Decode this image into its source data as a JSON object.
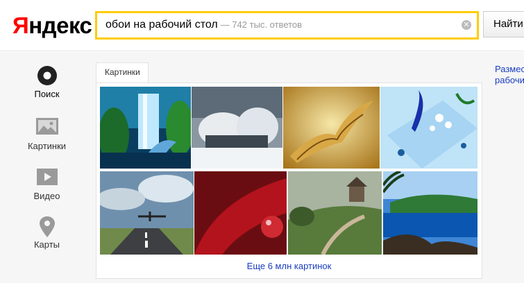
{
  "header": {
    "logo_first": "Я",
    "logo_rest": "ндекс",
    "search": {
      "query": "обои на рабочий стол",
      "hint": "— 742 тыс. ответов"
    },
    "search_button": "Найти"
  },
  "sidebar": {
    "items": [
      {
        "label": "Поиск",
        "icon": "search-circle-icon",
        "active": true
      },
      {
        "label": "Картинки",
        "icon": "image-icon",
        "active": false
      },
      {
        "label": "Видео",
        "icon": "video-play-icon",
        "active": false
      },
      {
        "label": "Карты",
        "icon": "map-pin-icon",
        "active": false
      }
    ]
  },
  "main": {
    "tab_label": "Картинки",
    "images": [
      {
        "name": "waterfall-dolphin-image"
      },
      {
        "name": "snowy-forest-image"
      },
      {
        "name": "book-pages-image"
      },
      {
        "name": "blue-ribbon-flowers-image"
      },
      {
        "name": "airplane-runway-image"
      },
      {
        "name": "red-leaf-drop-image"
      },
      {
        "name": "house-on-hill-image"
      },
      {
        "name": "tropical-coast-image"
      }
    ],
    "more_link": "Еще 6 млн картинок"
  },
  "right": {
    "line1": "Размес",
    "line2": "рабочи"
  },
  "colors": {
    "logo_red": "#ff0000",
    "search_border": "#ffcc00",
    "link_blue": "#1a3dc1"
  }
}
